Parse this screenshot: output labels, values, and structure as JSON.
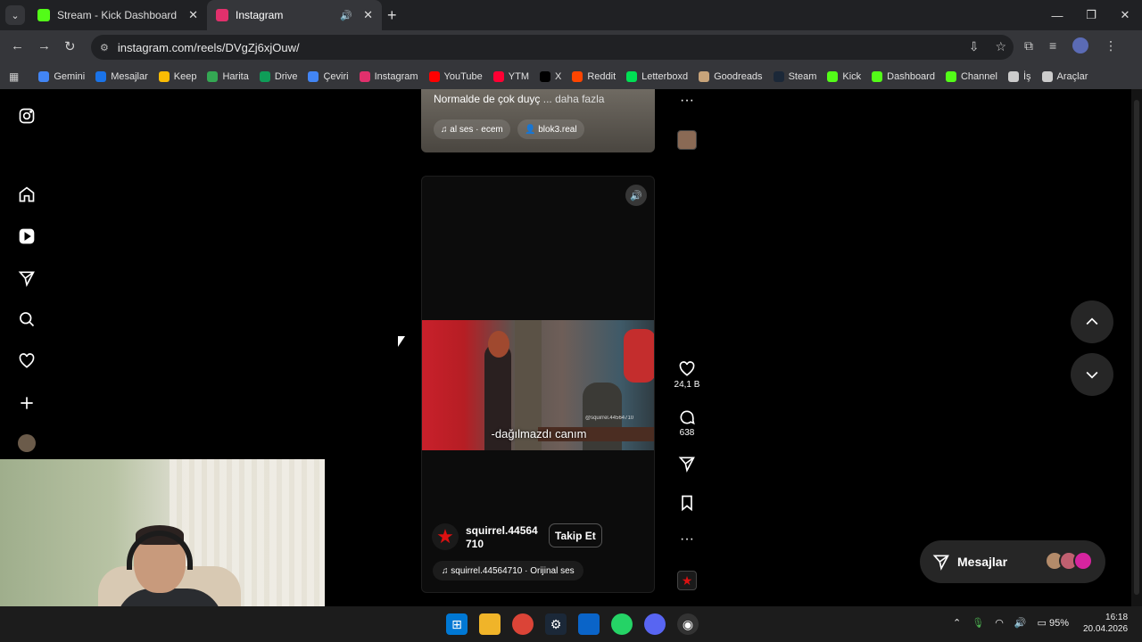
{
  "browser": {
    "tabs": [
      {
        "label": "Stream - Kick Dashboard",
        "favicon_color": "#53fc18"
      },
      {
        "label": "Instagram",
        "favicon_color": "#e1306c"
      }
    ],
    "url": "instagram.com/reels/DVgZj6xjOuw/"
  },
  "bookmarks": [
    {
      "label": "Gemini",
      "color": "#4285f4"
    },
    {
      "label": "Mesajlar",
      "color": "#1a73e8"
    },
    {
      "label": "Keep",
      "color": "#fbbc04"
    },
    {
      "label": "Harita",
      "color": "#34a853"
    },
    {
      "label": "Drive",
      "color": "#0f9d58"
    },
    {
      "label": "Çeviri",
      "color": "#4285f4"
    },
    {
      "label": "Instagram",
      "color": "#e1306c"
    },
    {
      "label": "YouTube",
      "color": "#ff0000"
    },
    {
      "label": "YTM",
      "color": "#ff0033"
    },
    {
      "label": "X",
      "color": "#000000"
    },
    {
      "label": "Reddit",
      "color": "#ff4500"
    },
    {
      "label": "Letterboxd",
      "color": "#00e054"
    },
    {
      "label": "Goodreads",
      "color": "#c8a47a"
    },
    {
      "label": "Steam",
      "color": "#1b2838"
    },
    {
      "label": "Kick",
      "color": "#53fc18"
    },
    {
      "label": "Dashboard",
      "color": "#53fc18"
    },
    {
      "label": "Channel",
      "color": "#53fc18"
    },
    {
      "label": "İş",
      "color": "#cccccc"
    },
    {
      "label": "Araçlar",
      "color": "#cccccc"
    }
  ],
  "prev_reel": {
    "caption": "Normalde de çok duyç",
    "more": "... daha fazla",
    "audio_pill": "al ses · ecem",
    "user_pill": "blok3.real"
  },
  "reel": {
    "subtitle": "-dağılmazdı canım",
    "watermark": "@squirrel.44564710",
    "username": "squirrel.44564710",
    "follow_label": "Takip Et",
    "audio_label": "squirrel.44564710 · Orijinal ses",
    "likes": "24,1 B",
    "comments": "638"
  },
  "messages": {
    "label": "Mesajlar"
  },
  "system": {
    "battery": "95%",
    "time": "16:18",
    "date": "20.04.2026"
  }
}
